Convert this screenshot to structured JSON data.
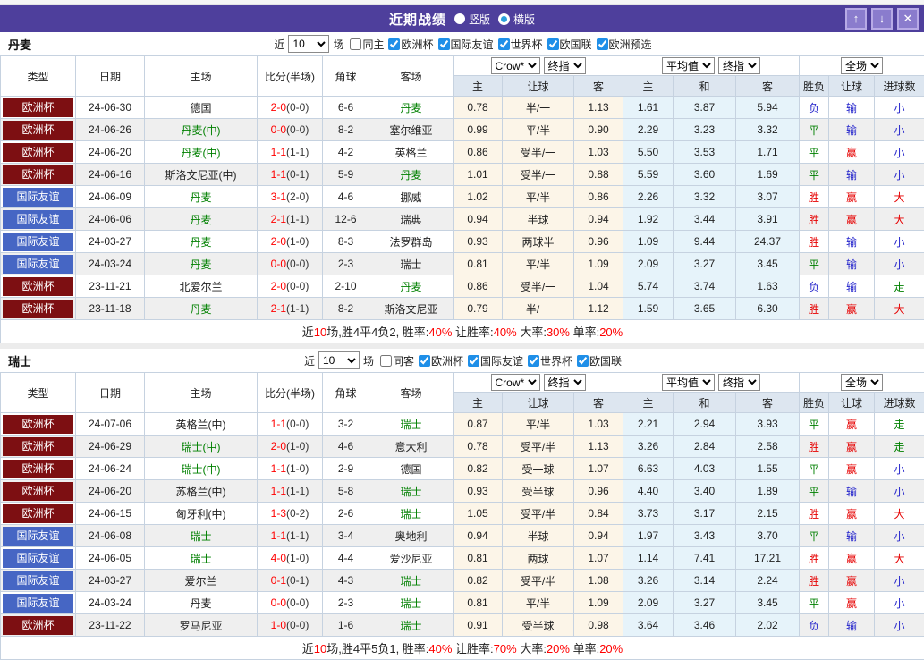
{
  "topbar": {
    "title": "近期战绩",
    "radio_vertical": {
      "label": "竖版",
      "selected": true
    },
    "radio_horizontal": {
      "label": "横版",
      "selected": false
    },
    "up_glyph": "↑",
    "down_glyph": "↓",
    "close_glyph": "✕",
    "bar_color": "#4e3f9c"
  },
  "header": {
    "left_cols": [
      "类型",
      "日期",
      "主场",
      "比分(半场)",
      "角球",
      "客场"
    ],
    "sub_cols": [
      "主",
      "让球",
      "客",
      "主",
      "和",
      "客",
      "胜负",
      "让球",
      "进球数"
    ],
    "odds_selects": [
      "Crow*",
      "终指"
    ],
    "avg_selects": [
      "平均值",
      "终指"
    ],
    "scope_selects": [
      "全场"
    ]
  },
  "league_colors": {
    "欧洲杯": "#7d0f12",
    "国际友谊": "#4666c4"
  },
  "result_colors": {
    "胜": "#e60000",
    "平": "#008000",
    "负": "#2626cc",
    "赢": "#e60000",
    "输": "#2626cc",
    "大": "#e60000",
    "小": "#2626cc",
    "走": "#008000"
  },
  "sections": [
    {
      "title": "丹麦",
      "filter": {
        "near": "近",
        "count": "10",
        "games": "场",
        "same": "同主",
        "same_checked": false,
        "leagues": [
          "欧洲杯",
          "国际友谊",
          "世界杯",
          "欧国联",
          "欧洲预选"
        ]
      },
      "rows": [
        {
          "type": "欧洲杯",
          "date": "24-06-30",
          "home": "德国",
          "home_green": false,
          "score": "2-0",
          "half": "(0-0)",
          "corner": "6-6",
          "away": "丹麦",
          "away_green": true,
          "odds": [
            "0.78",
            "半/一",
            "1.13"
          ],
          "avg": [
            "1.61",
            "3.87",
            "5.94"
          ],
          "results": [
            "负",
            "输",
            "小"
          ]
        },
        {
          "type": "欧洲杯",
          "date": "24-06-26",
          "home": "丹麦(中)",
          "home_green": true,
          "score": "0-0",
          "half": "(0-0)",
          "corner": "8-2",
          "away": "塞尔维亚",
          "away_green": false,
          "odds": [
            "0.99",
            "平/半",
            "0.90"
          ],
          "avg": [
            "2.29",
            "3.23",
            "3.32"
          ],
          "results": [
            "平",
            "输",
            "小"
          ]
        },
        {
          "type": "欧洲杯",
          "date": "24-06-20",
          "home": "丹麦(中)",
          "home_green": true,
          "score": "1-1",
          "half": "(1-1)",
          "corner": "4-2",
          "away": "英格兰",
          "away_green": false,
          "odds": [
            "0.86",
            "受半/一",
            "1.03"
          ],
          "avg": [
            "5.50",
            "3.53",
            "1.71"
          ],
          "results": [
            "平",
            "赢",
            "小"
          ]
        },
        {
          "type": "欧洲杯",
          "date": "24-06-16",
          "home": "斯洛文尼亚(中)",
          "home_green": false,
          "score": "1-1",
          "half": "(0-1)",
          "corner": "5-9",
          "away": "丹麦",
          "away_green": true,
          "odds": [
            "1.01",
            "受半/一",
            "0.88"
          ],
          "avg": [
            "5.59",
            "3.60",
            "1.69"
          ],
          "results": [
            "平",
            "输",
            "小"
          ]
        },
        {
          "type": "国际友谊",
          "date": "24-06-09",
          "home": "丹麦",
          "home_green": true,
          "score": "3-1",
          "half": "(2-0)",
          "corner": "4-6",
          "away": "挪威",
          "away_green": false,
          "odds": [
            "1.02",
            "平/半",
            "0.86"
          ],
          "avg": [
            "2.26",
            "3.32",
            "3.07"
          ],
          "results": [
            "胜",
            "赢",
            "大"
          ]
        },
        {
          "type": "国际友谊",
          "date": "24-06-06",
          "home": "丹麦",
          "home_green": true,
          "score": "2-1",
          "half": "(1-1)",
          "corner": "12-6",
          "away": "瑞典",
          "away_green": false,
          "odds": [
            "0.94",
            "半球",
            "0.94"
          ],
          "avg": [
            "1.92",
            "3.44",
            "3.91"
          ],
          "results": [
            "胜",
            "赢",
            "大"
          ]
        },
        {
          "type": "国际友谊",
          "date": "24-03-27",
          "home": "丹麦",
          "home_green": true,
          "score": "2-0",
          "half": "(1-0)",
          "corner": "8-3",
          "away": "法罗群岛",
          "away_green": false,
          "odds": [
            "0.93",
            "两球半",
            "0.96"
          ],
          "avg": [
            "1.09",
            "9.44",
            "24.37"
          ],
          "results": [
            "胜",
            "输",
            "小"
          ]
        },
        {
          "type": "国际友谊",
          "date": "24-03-24",
          "home": "丹麦",
          "home_green": true,
          "score": "0-0",
          "half": "(0-0)",
          "corner": "2-3",
          "away": "瑞士",
          "away_green": false,
          "odds": [
            "0.81",
            "平/半",
            "1.09"
          ],
          "avg": [
            "2.09",
            "3.27",
            "3.45"
          ],
          "results": [
            "平",
            "输",
            "小"
          ]
        },
        {
          "type": "欧洲杯",
          "date": "23-11-21",
          "home": "北爱尔兰",
          "home_green": false,
          "score": "2-0",
          "half": "(0-0)",
          "corner": "2-10",
          "away": "丹麦",
          "away_green": true,
          "odds": [
            "0.86",
            "受半/一",
            "1.04"
          ],
          "avg": [
            "5.74",
            "3.74",
            "1.63"
          ],
          "results": [
            "负",
            "输",
            "走"
          ]
        },
        {
          "type": "欧洲杯",
          "date": "23-11-18",
          "home": "丹麦",
          "home_green": true,
          "score": "2-1",
          "half": "(1-1)",
          "corner": "8-2",
          "away": "斯洛文尼亚",
          "away_green": false,
          "odds": [
            "0.79",
            "半/一",
            "1.12"
          ],
          "avg": [
            "1.59",
            "3.65",
            "6.30"
          ],
          "results": [
            "胜",
            "赢",
            "大"
          ]
        }
      ],
      "summary": [
        {
          "t": "近"
        },
        {
          "t": "10",
          "red": true
        },
        {
          "t": "场,胜4平4负2, 胜率:"
        },
        {
          "t": "40%",
          "red": true
        },
        {
          "t": " 让胜率:"
        },
        {
          "t": "40%",
          "red": true
        },
        {
          "t": " 大率:"
        },
        {
          "t": "30%",
          "red": true
        },
        {
          "t": " 单率:"
        },
        {
          "t": "20%",
          "red": true
        }
      ]
    },
    {
      "title": "瑞士",
      "filter": {
        "near": "近",
        "count": "10",
        "games": "场",
        "same": "同客",
        "same_checked": false,
        "leagues": [
          "欧洲杯",
          "国际友谊",
          "世界杯",
          "欧国联"
        ]
      },
      "rows": [
        {
          "type": "欧洲杯",
          "date": "24-07-06",
          "home": "英格兰(中)",
          "home_green": false,
          "score": "1-1",
          "half": "(0-0)",
          "corner": "3-2",
          "away": "瑞士",
          "away_green": true,
          "odds": [
            "0.87",
            "平/半",
            "1.03"
          ],
          "avg": [
            "2.21",
            "2.94",
            "3.93"
          ],
          "results": [
            "平",
            "赢",
            "走"
          ]
        },
        {
          "type": "欧洲杯",
          "date": "24-06-29",
          "home": "瑞士(中)",
          "home_green": true,
          "score": "2-0",
          "half": "(1-0)",
          "corner": "4-6",
          "away": "意大利",
          "away_green": false,
          "odds": [
            "0.78",
            "受平/半",
            "1.13"
          ],
          "avg": [
            "3.26",
            "2.84",
            "2.58"
          ],
          "results": [
            "胜",
            "赢",
            "走"
          ]
        },
        {
          "type": "欧洲杯",
          "date": "24-06-24",
          "home": "瑞士(中)",
          "home_green": true,
          "score": "1-1",
          "half": "(1-0)",
          "corner": "2-9",
          "away": "德国",
          "away_green": false,
          "odds": [
            "0.82",
            "受一球",
            "1.07"
          ],
          "avg": [
            "6.63",
            "4.03",
            "1.55"
          ],
          "results": [
            "平",
            "赢",
            "小"
          ]
        },
        {
          "type": "欧洲杯",
          "date": "24-06-20",
          "home": "苏格兰(中)",
          "home_green": false,
          "score": "1-1",
          "half": "(1-1)",
          "corner": "5-8",
          "away": "瑞士",
          "away_green": true,
          "odds": [
            "0.93",
            "受半球",
            "0.96"
          ],
          "avg": [
            "4.40",
            "3.40",
            "1.89"
          ],
          "results": [
            "平",
            "输",
            "小"
          ]
        },
        {
          "type": "欧洲杯",
          "date": "24-06-15",
          "home": "匈牙利(中)",
          "home_green": false,
          "score": "1-3",
          "half": "(0-2)",
          "corner": "2-6",
          "away": "瑞士",
          "away_green": true,
          "odds": [
            "1.05",
            "受平/半",
            "0.84"
          ],
          "avg": [
            "3.73",
            "3.17",
            "2.15"
          ],
          "results": [
            "胜",
            "赢",
            "大"
          ]
        },
        {
          "type": "国际友谊",
          "date": "24-06-08",
          "home": "瑞士",
          "home_green": true,
          "score": "1-1",
          "half": "(1-1)",
          "corner": "3-4",
          "away": "奥地利",
          "away_green": false,
          "odds": [
            "0.94",
            "半球",
            "0.94"
          ],
          "avg": [
            "1.97",
            "3.43",
            "3.70"
          ],
          "results": [
            "平",
            "输",
            "小"
          ]
        },
        {
          "type": "国际友谊",
          "date": "24-06-05",
          "home": "瑞士",
          "home_green": true,
          "score": "4-0",
          "half": "(1-0)",
          "corner": "4-4",
          "away": "爱沙尼亚",
          "away_green": false,
          "odds": [
            "0.81",
            "两球",
            "1.07"
          ],
          "avg": [
            "1.14",
            "7.41",
            "17.21"
          ],
          "results": [
            "胜",
            "赢",
            "大"
          ]
        },
        {
          "type": "国际友谊",
          "date": "24-03-27",
          "home": "爱尔兰",
          "home_green": false,
          "score": "0-1",
          "half": "(0-1)",
          "corner": "4-3",
          "away": "瑞士",
          "away_green": true,
          "odds": [
            "0.82",
            "受平/半",
            "1.08"
          ],
          "avg": [
            "3.26",
            "3.14",
            "2.24"
          ],
          "results": [
            "胜",
            "赢",
            "小"
          ]
        },
        {
          "type": "国际友谊",
          "date": "24-03-24",
          "home": "丹麦",
          "home_green": false,
          "score": "0-0",
          "half": "(0-0)",
          "corner": "2-3",
          "away": "瑞士",
          "away_green": true,
          "odds": [
            "0.81",
            "平/半",
            "1.09"
          ],
          "avg": [
            "2.09",
            "3.27",
            "3.45"
          ],
          "results": [
            "平",
            "赢",
            "小"
          ]
        },
        {
          "type": "欧洲杯",
          "date": "23-11-22",
          "home": "罗马尼亚",
          "home_green": false,
          "score": "1-0",
          "half": "(0-0)",
          "corner": "1-6",
          "away": "瑞士",
          "away_green": true,
          "odds": [
            "0.91",
            "受半球",
            "0.98"
          ],
          "avg": [
            "3.64",
            "3.46",
            "2.02"
          ],
          "results": [
            "负",
            "输",
            "小"
          ]
        }
      ],
      "summary": [
        {
          "t": "近"
        },
        {
          "t": "10",
          "red": true
        },
        {
          "t": "场,胜4平5负1, 胜率:"
        },
        {
          "t": "40%",
          "red": true
        },
        {
          "t": " 让胜率:"
        },
        {
          "t": "70%",
          "red": true
        },
        {
          "t": " 大率:"
        },
        {
          "t": "20%",
          "red": true
        },
        {
          "t": " 单率:"
        },
        {
          "t": "20%",
          "red": true
        }
      ]
    }
  ]
}
